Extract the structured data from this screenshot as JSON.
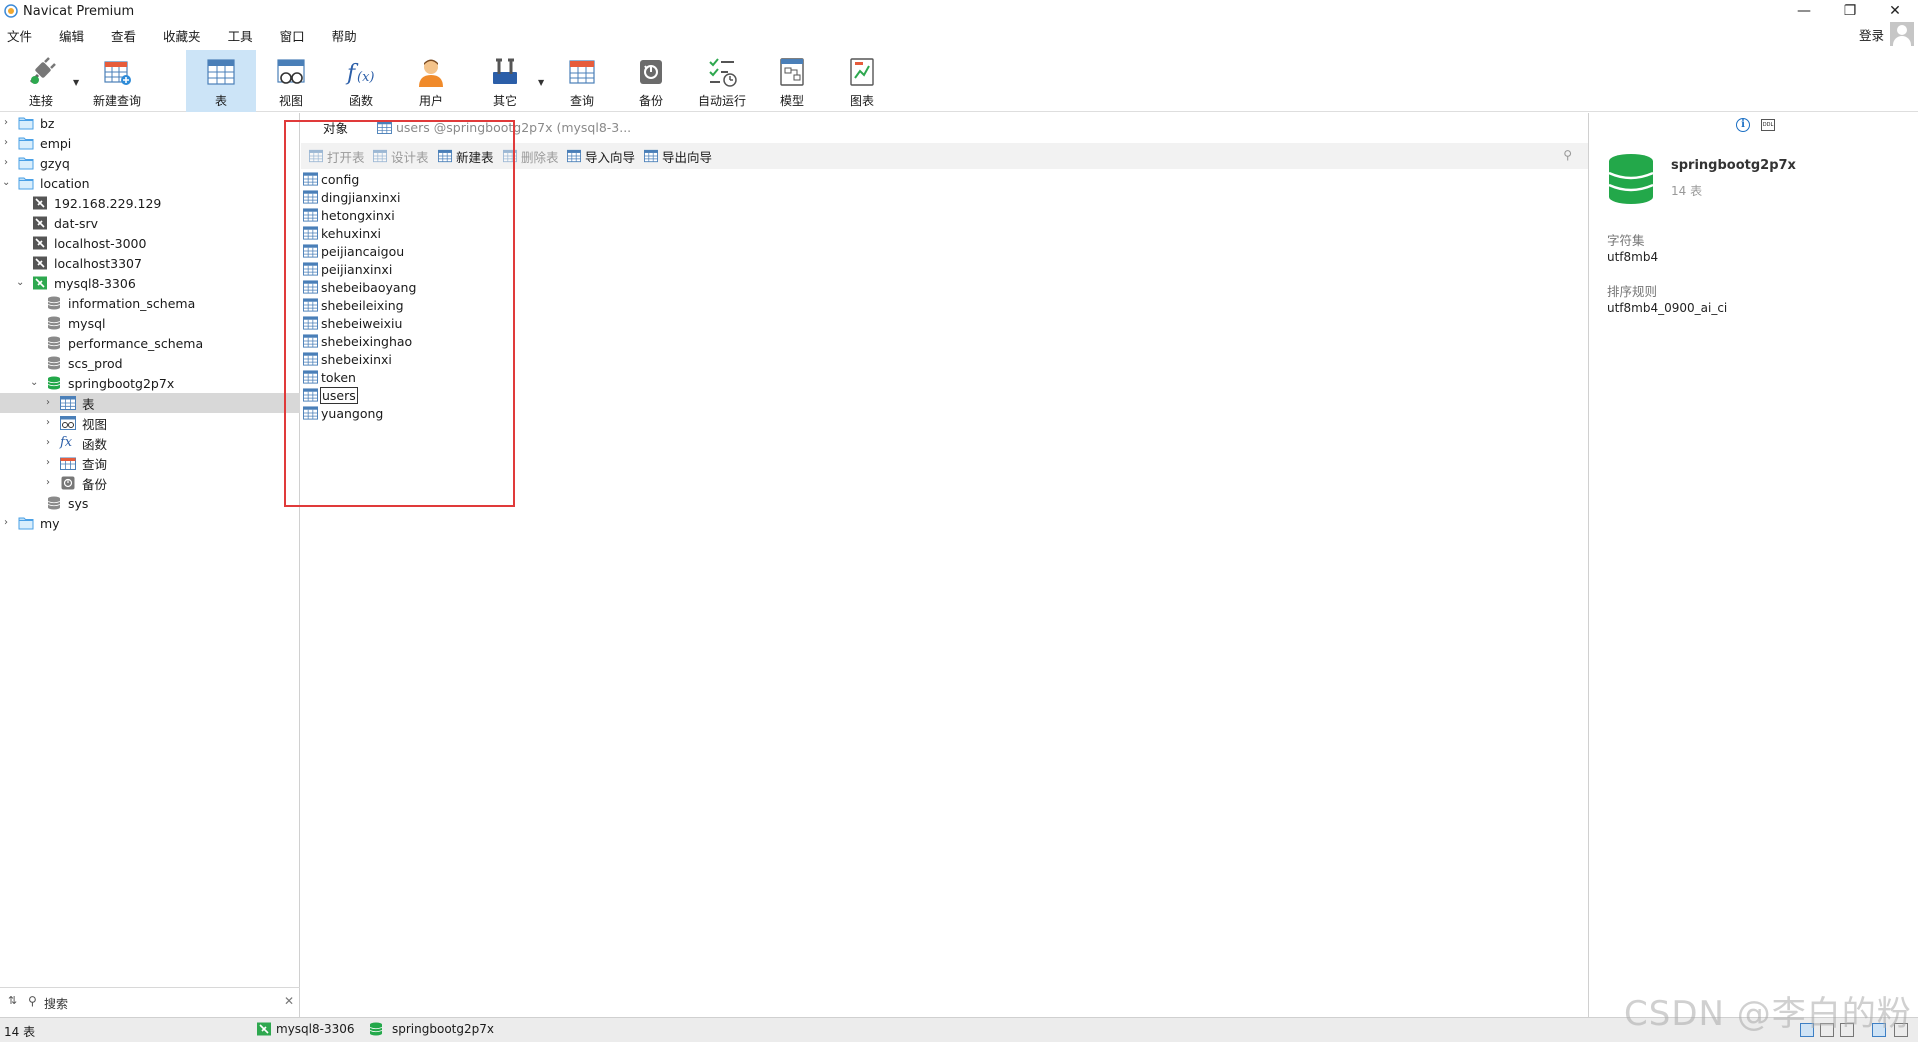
{
  "window": {
    "title": "Navicat Premium"
  },
  "menu": [
    "文件",
    "编辑",
    "查看",
    "收藏夹",
    "工具",
    "窗口",
    "帮助"
  ],
  "login_label": "登录",
  "toolbar": {
    "connect": "连接",
    "new_query": "新建查询",
    "table": "表",
    "view": "视图",
    "function": "函数",
    "user": "用户",
    "other": "其它",
    "query": "查询",
    "backup": "备份",
    "autorun": "自动运行",
    "model": "模型",
    "chart": "图表"
  },
  "tree": [
    {
      "label": "bz"
    },
    {
      "label": "empi"
    },
    {
      "label": "gzyq"
    },
    {
      "label": "location"
    },
    {
      "label": "192.168.229.129"
    },
    {
      "label": "dat-srv"
    },
    {
      "label": "localhost-3000"
    },
    {
      "label": "localhost3307"
    },
    {
      "label": "mysql8-3306"
    },
    {
      "label": "information_schema"
    },
    {
      "label": "mysql"
    },
    {
      "label": "performance_schema"
    },
    {
      "label": "scs_prod"
    },
    {
      "label": "springbootg2p7x"
    },
    {
      "label": "表"
    },
    {
      "label": "视图"
    },
    {
      "label": "函数"
    },
    {
      "label": "查询"
    },
    {
      "label": "备份"
    },
    {
      "label": "sys"
    },
    {
      "label": "my"
    }
  ],
  "search_placeholder": "搜索",
  "tabs": {
    "objects": "对象",
    "users": "users @springbootg2p7x (mysql8-3..."
  },
  "object_toolbar": {
    "open": "打开表",
    "design": "设计表",
    "new": "新建表",
    "delete": "删除表",
    "import": "导入向导",
    "export": "导出向导"
  },
  "tables": [
    "config",
    "dingjianxinxi",
    "hetongxinxi",
    "kehuxinxi",
    "peijiancaigou",
    "peijianxinxi",
    "shebeibaoyang",
    "shebeileixing",
    "shebeiweixiu",
    "shebeixinghao",
    "shebeixinxi",
    "token",
    "users",
    "yuangong"
  ],
  "info": {
    "db_name": "springbootg2p7x",
    "table_count": "14 表",
    "charset_label": "字符集",
    "charset_value": "utf8mb4",
    "collation_label": "排序规则",
    "collation_value": "utf8mb4_0900_ai_ci",
    "ddl_label": "DDL"
  },
  "status": {
    "count": "14 表",
    "connection": "mysql8-3306",
    "database": "springbootg2p7x"
  },
  "watermark": "CSDN @李白的粉",
  "colors": {
    "accent": "#cce4f7",
    "highlight_box": "#e03a3a",
    "db_green": "#23a84a",
    "folder_blue": "#4aa0e6"
  }
}
